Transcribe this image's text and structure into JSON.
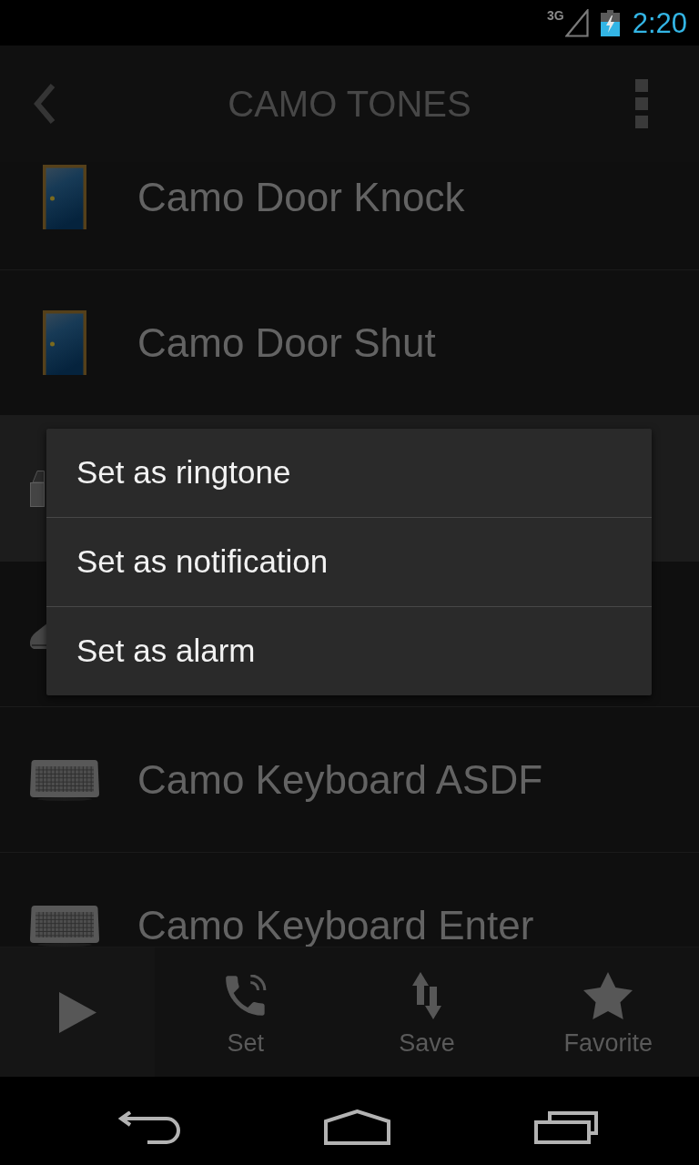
{
  "status_bar": {
    "network": "3G",
    "time": "2:20"
  },
  "app_bar": {
    "title": "CAMO TONES"
  },
  "tones": [
    {
      "title": "Camo Door Knock",
      "kind": "door",
      "selected": false
    },
    {
      "title": "Camo Door Shut",
      "kind": "door",
      "selected": false
    },
    {
      "kind": "box",
      "selected": true
    },
    {
      "kind": "slab",
      "selected": false
    },
    {
      "title": "Camo Keyboard ASDF",
      "kind": "keyboard",
      "selected": false
    },
    {
      "title": "Camo Keyboard Enter",
      "kind": "keyboard",
      "selected": false
    }
  ],
  "context_menu": {
    "items": [
      "Set as ringtone",
      "Set as notification",
      "Set as alarm"
    ]
  },
  "action_bar": {
    "actions": [
      {
        "label": "Set",
        "kind": "set"
      },
      {
        "label": "Save",
        "kind": "save"
      },
      {
        "label": "Favorite",
        "kind": "favorite"
      }
    ]
  }
}
